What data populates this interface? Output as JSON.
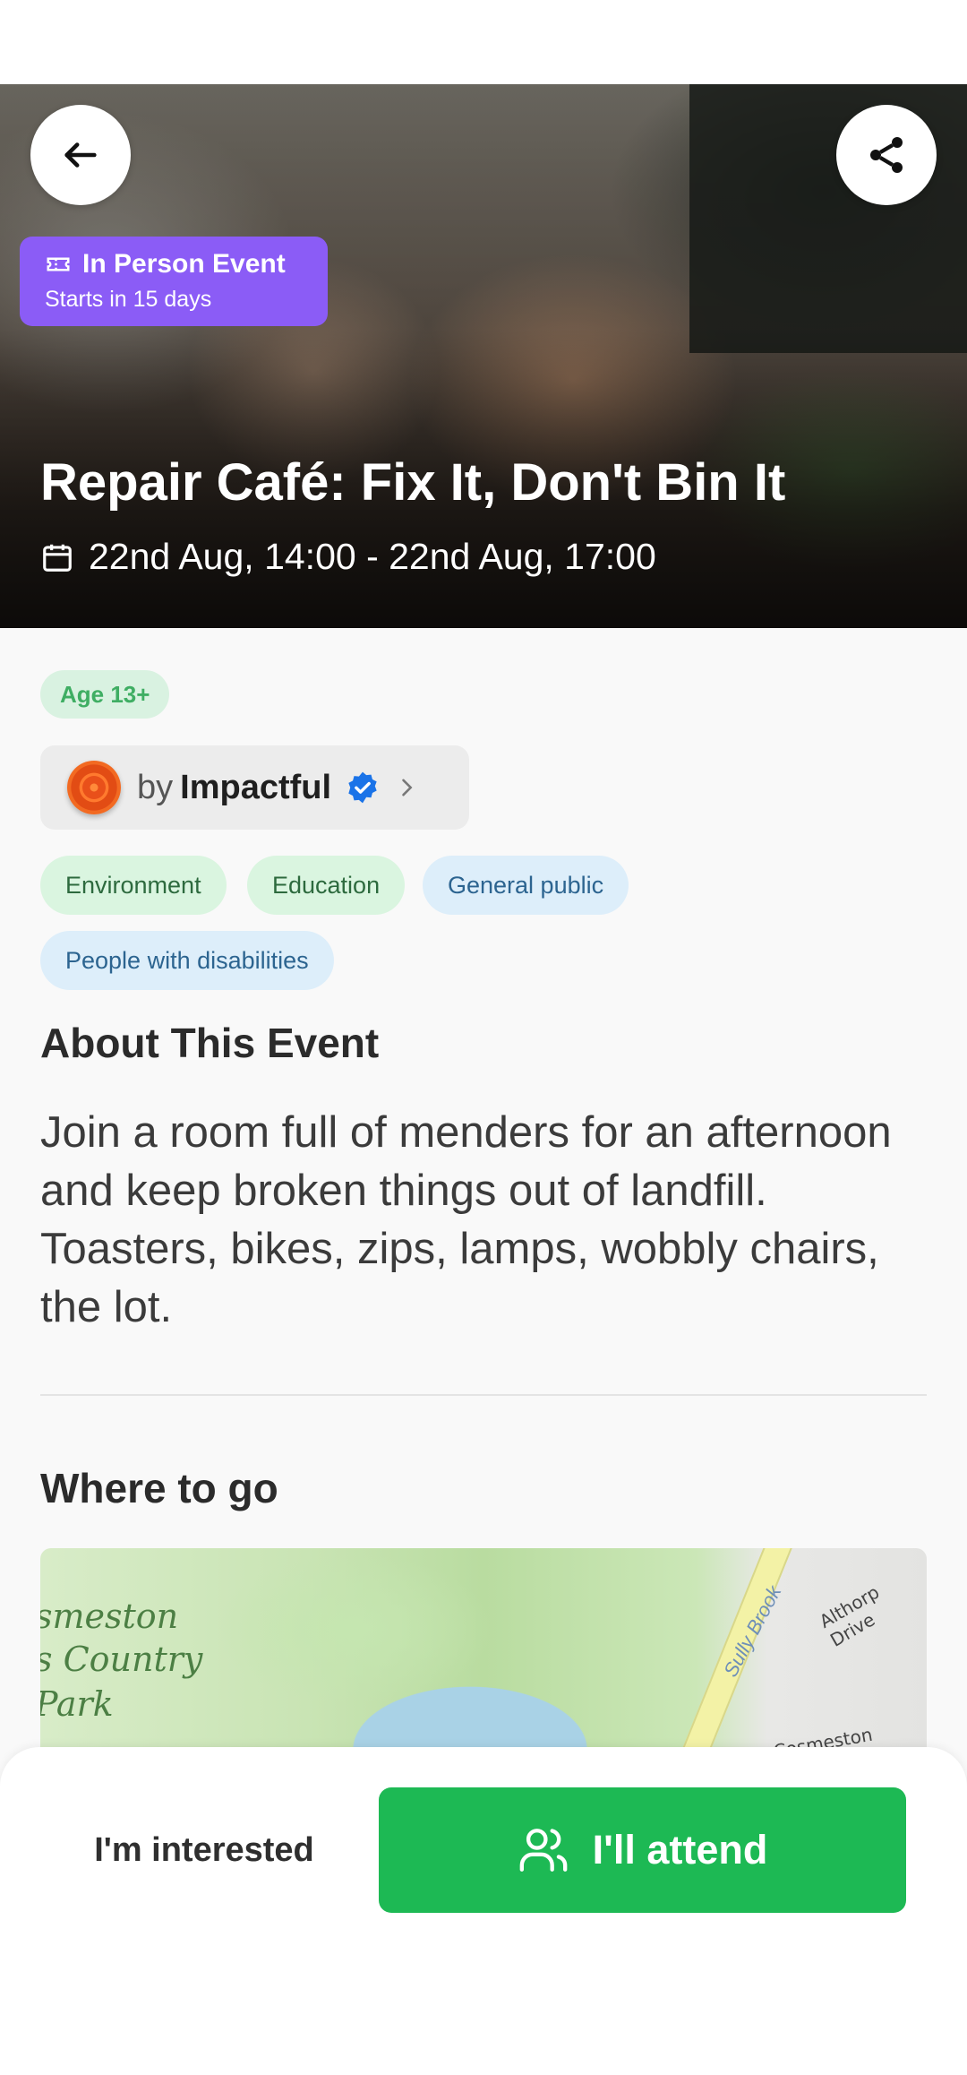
{
  "hero": {
    "title": "Repair Café: Fix It, Don't Bin It",
    "date_range": "22nd Aug, 14:00 - 22nd Aug, 17:00",
    "badge": {
      "title": "In Person Event",
      "subtitle": "Starts in 15 days",
      "color": "#8b5cf6"
    },
    "back_icon": "arrow-left-icon",
    "share_icon": "share-icon"
  },
  "age_chip": "Age 13+",
  "organizer": {
    "prefix": "by",
    "name": "Impactful",
    "verified_icon": "verified-badge-icon",
    "chevron_icon": "chevron-right-icon"
  },
  "tags": [
    {
      "label": "Environment",
      "style": "green"
    },
    {
      "label": "Education",
      "style": "green"
    },
    {
      "label": "General public",
      "style": "blue"
    },
    {
      "label": "People with disabilities",
      "style": "blue"
    }
  ],
  "about": {
    "heading": "About This Event",
    "text": "Join a room full of menders for an afternoon and keep broken things out of landfill. Toasters, bikes, zips, lamps, wobbly chairs, the lot."
  },
  "where": {
    "heading": "Where to go",
    "map_labels": {
      "park_line1": "smeston",
      "park_line2": "s Country",
      "park_line3": "Park",
      "stream": "Sully Brook",
      "road1": "Althorp Drive",
      "road2": "Cosmeston Drive"
    }
  },
  "actions": {
    "interested": "I'm interested",
    "attend": "I'll attend",
    "attend_icon": "users-icon",
    "attend_color": "#1db954"
  }
}
